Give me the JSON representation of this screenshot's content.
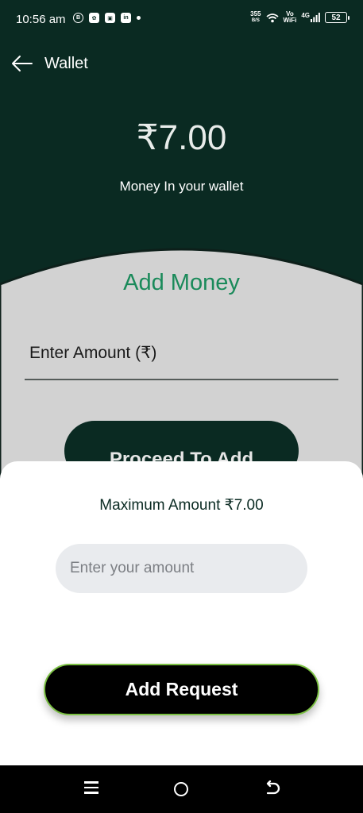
{
  "status_bar": {
    "time": "10:56 am",
    "speed_value": "355",
    "speed_unit": "B/S",
    "vo_label": "Vo",
    "wifi_label": "WiFi",
    "network_label": "4G",
    "battery": "52",
    "left_icons": [
      "b-icon",
      "photo-icon",
      "chat-icon",
      "linkedin-icon",
      "dot"
    ]
  },
  "header": {
    "title": "Wallet"
  },
  "wallet": {
    "balance": "₹7.00",
    "balance_label": "Money In your wallet"
  },
  "add_money": {
    "title": "Add Money",
    "amount_label": "Enter Amount (₹)",
    "proceed_label": "Proceed To Add"
  },
  "sheet": {
    "max_amount": "Maximum Amount ₹7.00",
    "input_placeholder": "Enter your amount",
    "add_request_label": "Add Request"
  },
  "colors": {
    "primary_dark": "#0a2a22",
    "accent_green": "#1a8a5a",
    "button_border": "#7bc043"
  }
}
